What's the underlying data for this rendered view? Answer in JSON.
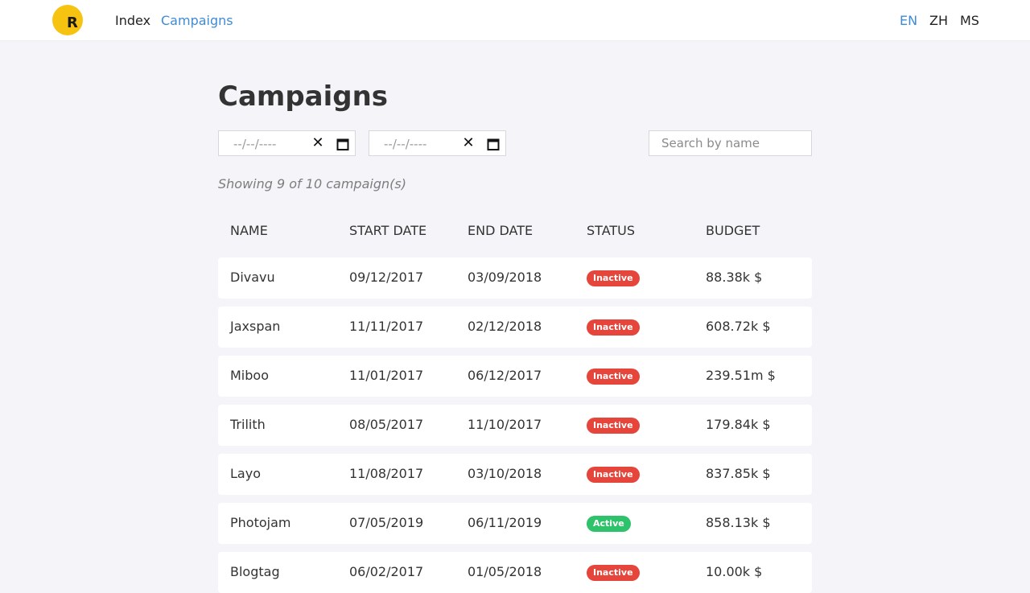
{
  "nav": {
    "logo_letter": "R",
    "links": [
      {
        "label": "Index",
        "active": false
      },
      {
        "label": "Campaigns",
        "active": true
      }
    ],
    "languages": [
      {
        "label": "EN",
        "active": true
      },
      {
        "label": "ZH",
        "active": false
      },
      {
        "label": "MS",
        "active": false
      }
    ]
  },
  "page": {
    "title": "Campaigns",
    "start_date_placeholder": "--/--/----",
    "end_date_placeholder": "--/--/----",
    "search_placeholder": "Search by name",
    "showing_text": "Showing 9 of 10 campaign(s)"
  },
  "table": {
    "columns": [
      "NAME",
      "START DATE",
      "END DATE",
      "STATUS",
      "BUDGET"
    ],
    "rows": [
      {
        "name": "Divavu",
        "start": "09/12/2017",
        "end": "03/09/2018",
        "status": "Inactive",
        "budget": "88.38k $"
      },
      {
        "name": "Jaxspan",
        "start": "11/11/2017",
        "end": "02/12/2018",
        "status": "Inactive",
        "budget": "608.72k $"
      },
      {
        "name": "Miboo",
        "start": "11/01/2017",
        "end": "06/12/2017",
        "status": "Inactive",
        "budget": "239.51m $"
      },
      {
        "name": "Trilith",
        "start": "08/05/2017",
        "end": "11/10/2017",
        "status": "Inactive",
        "budget": "179.84k $"
      },
      {
        "name": "Layo",
        "start": "11/08/2017",
        "end": "03/10/2018",
        "status": "Inactive",
        "budget": "837.85k $"
      },
      {
        "name": "Photojam",
        "start": "07/05/2019",
        "end": "06/11/2019",
        "status": "Active",
        "budget": "858.13k $"
      },
      {
        "name": "Blogtag",
        "start": "06/02/2017",
        "end": "01/05/2018",
        "status": "Inactive",
        "budget": "10.00k $"
      }
    ]
  },
  "colors": {
    "accent": "#3e8bd6",
    "logo": "#f6c310",
    "inactive": "#e5453a",
    "active": "#2ec36a"
  },
  "icons": {
    "clear": "close-icon",
    "calendar": "calendar-icon"
  }
}
